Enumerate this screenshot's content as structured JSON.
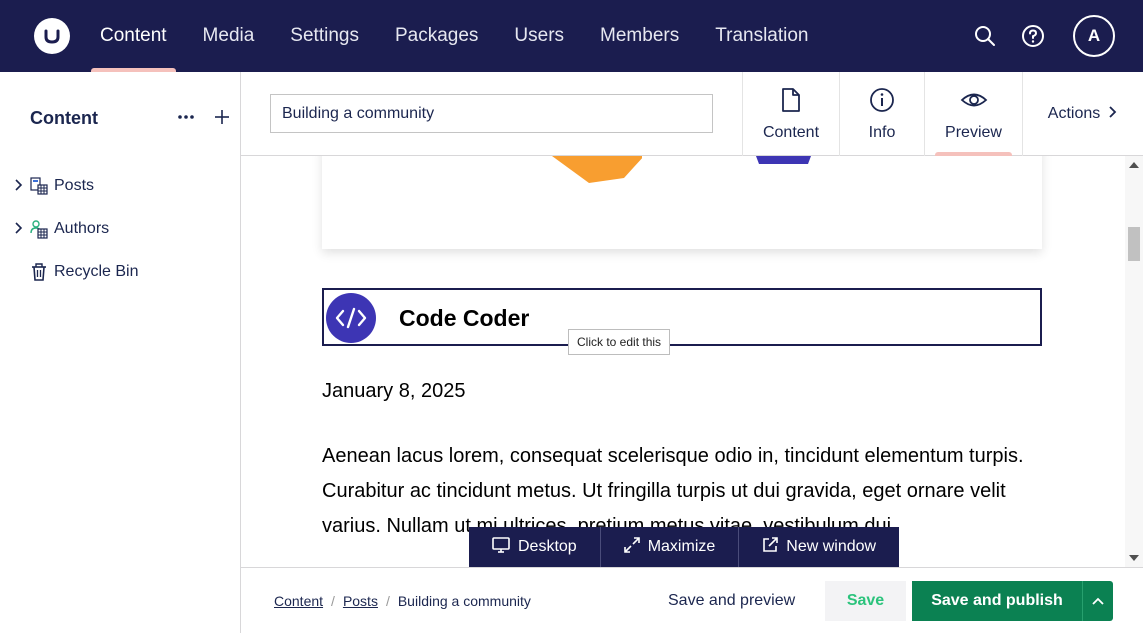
{
  "topbar": {
    "logo_icon": "umbraco-logo-icon",
    "nav": [
      {
        "label": "Content",
        "active": true
      },
      {
        "label": "Media"
      },
      {
        "label": "Settings"
      },
      {
        "label": "Packages"
      },
      {
        "label": "Users"
      },
      {
        "label": "Members"
      },
      {
        "label": "Translation"
      }
    ],
    "icons": [
      "search-icon",
      "help-icon"
    ],
    "avatar_initial": "A"
  },
  "sidebar": {
    "heading": "Content",
    "actions": [
      "more-icon",
      "plus-icon"
    ],
    "tree": [
      {
        "label": "Posts",
        "icon": "posts-list-icon",
        "expandable": true
      },
      {
        "label": "Authors",
        "icon": "authors-list-icon",
        "expandable": true
      },
      {
        "label": "Recycle Bin",
        "icon": "trash-icon",
        "expandable": false
      }
    ]
  },
  "workspace": {
    "name_value": "Building a community",
    "tabs": [
      {
        "label": "Content",
        "icon": "document-icon"
      },
      {
        "label": "Info",
        "icon": "info-icon"
      },
      {
        "label": "Preview",
        "icon": "eye-icon",
        "active": true
      }
    ],
    "actions_label": "Actions"
  },
  "preview": {
    "author_name": "Code Coder",
    "tooltip": "Click to edit this",
    "date": "January 8, 2025",
    "body": " Aenean lacus lorem, consequat scelerisque odio in, tincidunt elementum turpis. Curabitur ac tincidunt metus. Ut fringilla turpis ut dui gravida, eget ornare velit varius. Nullam ut mi ultrices, pretium metus vitae, vestibulum dui."
  },
  "device_bar": {
    "desktop": "Desktop",
    "maximize": "Maximize",
    "new_window": "New window"
  },
  "footer": {
    "breadcrumb": [
      "Content",
      "Posts",
      "Building a community"
    ],
    "save_preview": "Save and preview",
    "save": "Save",
    "save_publish": "Save and publish"
  },
  "colors": {
    "header_bg": "#1b1d4f",
    "accent_underline": "#f5c1bc",
    "publish_green": "#0b8152",
    "save_text_green": "#2bc37c",
    "author_icon_bg": "#3d35b4",
    "shape_orange": "#f89e30"
  }
}
